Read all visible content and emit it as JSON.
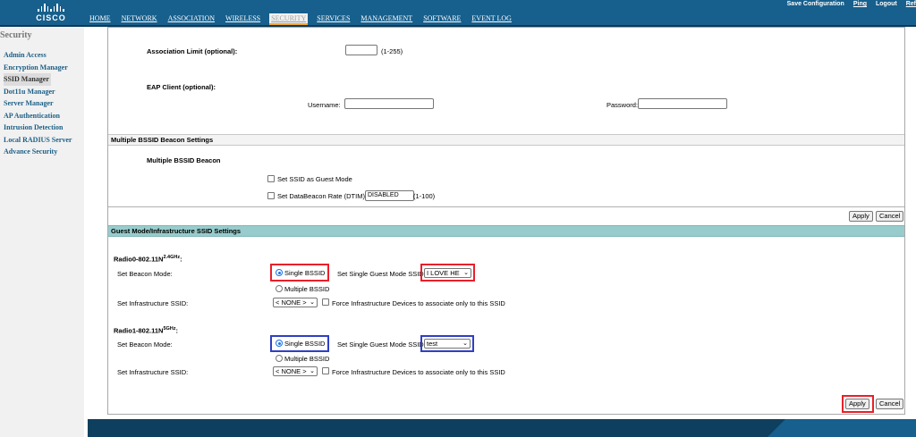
{
  "header": {
    "logo_text": "CISCO",
    "nav": [
      "HOME",
      "NETWORK",
      "ASSOCIATION",
      "WIRELESS",
      "SECURITY",
      "SERVICES",
      "MANAGEMENT",
      "SOFTWARE",
      "EVENT LOG"
    ],
    "active_nav": "SECURITY",
    "links": {
      "save_config": "Save Configuration",
      "ping": "Ping",
      "logout": "Logout",
      "refresh": "Ref"
    }
  },
  "sidebar": {
    "title": "Security",
    "items": [
      "Admin Access",
      "Encryption Manager",
      "SSID Manager",
      "Dot11u Manager",
      "Server Manager",
      "AP Authentication",
      "Intrusion Detection",
      "Local RADIUS Server",
      "Advance Security"
    ],
    "active": "SSID Manager"
  },
  "association": {
    "label": "Association Limit (optional):",
    "value": "",
    "range": "(1-255)"
  },
  "eap": {
    "label": "EAP Client (optional):",
    "username_label": "Username:",
    "username_value": "",
    "password_label": "Password:",
    "password_value": ""
  },
  "mbssid": {
    "section_title": "Multiple BSSID Beacon Settings",
    "subtitle": "Multiple BSSID Beacon",
    "guest_mode_label": "Set SSID as Guest Mode",
    "dtim_label": "Set DataBeacon Rate (DTIM):",
    "dtim_value": "DISABLED",
    "dtim_range": "(1-100)",
    "apply": "Apply",
    "cancel": "Cancel"
  },
  "guest": {
    "section_title": "Guest Mode/Infrastructure SSID Settings",
    "radio0": {
      "name": "Radio0-802.11N",
      "band": "2.4GHz",
      "beacon_mode_label": "Set Beacon Mode:",
      "single_bssid": "Single BSSID",
      "multiple_bssid": "Multiple BSSID",
      "guest_ssid_label": "Set Single Guest Mode SSID:",
      "guest_ssid_value": "I LOVE HE",
      "infra_label": "Set Infrastructure SSID:",
      "infra_value": "< NONE >",
      "force_label": "Force Infrastructure Devices to associate only to this SSID"
    },
    "radio1": {
      "name": "Radio1-802.11N",
      "band": "5GHz",
      "beacon_mode_label": "Set Beacon Mode:",
      "single_bssid": "Single BSSID",
      "multiple_bssid": "Multiple BSSID",
      "guest_ssid_label": "Set Single Guest Mode SSID:",
      "guest_ssid_value": "test",
      "infra_label": "Set Infrastructure SSID:",
      "infra_value": "< NONE >",
      "force_label": "Force Infrastructure Devices to associate only to this SSID"
    },
    "apply": "Apply",
    "cancel": "Cancel"
  },
  "colors": {
    "header_bg": "#175f8c",
    "teal_bar": "#98cccc",
    "highlight_red": "#e8202a",
    "highlight_blue": "#2f3fc4"
  }
}
